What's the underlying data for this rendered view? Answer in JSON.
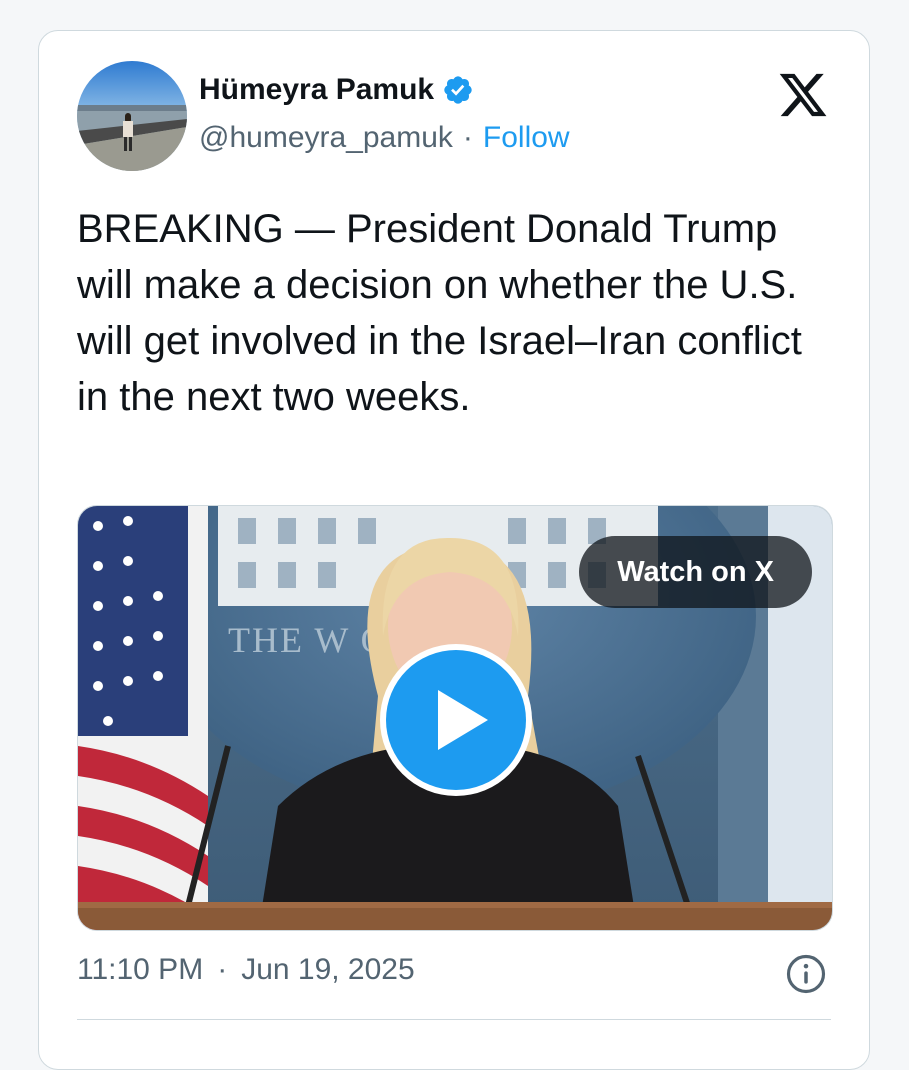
{
  "author": {
    "name": "Hümeyra Pamuk",
    "handle": "@humeyra_pamuk",
    "separator": "·",
    "follow_label": "Follow"
  },
  "tweet": {
    "text": "BREAKING — President Donald Trump will make a decision on whether the U.S. will get involved in the Israel–Iran conflict in the next two weeks."
  },
  "media": {
    "watch_label": "Watch on X",
    "backdrop_text": "THE W        OUSE"
  },
  "meta": {
    "time": "11:10 PM",
    "separator": "·",
    "date": "Jun 19, 2025"
  },
  "colors": {
    "accent": "#1d9bf0",
    "text": "#0f1419",
    "muted": "#536471"
  },
  "icons": {
    "verified": "verified-badge-icon",
    "platform": "x-logo-icon",
    "play": "play-icon",
    "info": "info-icon"
  }
}
